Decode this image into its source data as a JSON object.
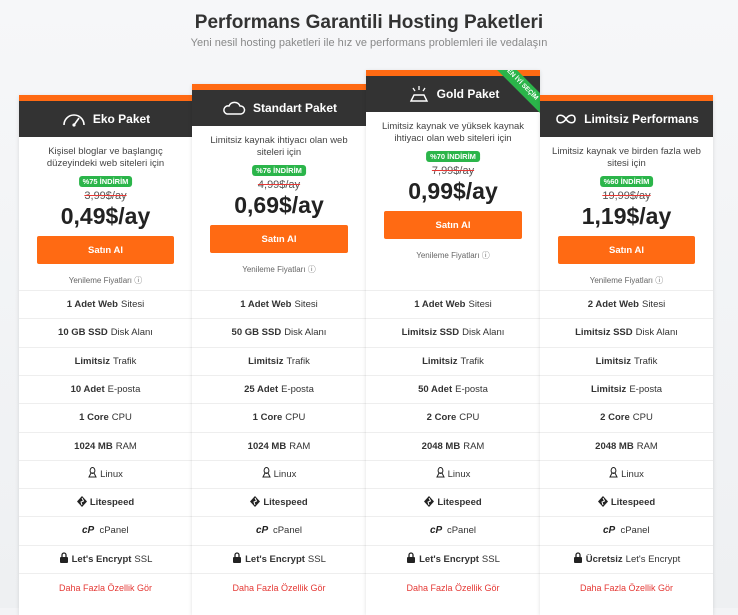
{
  "page": {
    "title": "Performans Garantili Hosting Paketleri",
    "subtitle": "Yeni nesil hosting paketleri ile hız ve performans problemleri ile vedalaşın"
  },
  "plans": [
    {
      "name": "Eko Paket",
      "icon": "speedometer-icon",
      "description": "Kişisel bloglar ve başlangıç düzeyindeki web siteleri için",
      "discount": "%75 İNDİRİM",
      "old_price": "3,99$/ay",
      "price": "0,49$/ay",
      "cta": "Satın Al",
      "renewal": "Yenileme Fiyatları",
      "features": [
        {
          "bold": "1 Adet Web",
          "rest": "Sitesi"
        },
        {
          "bold": "10 GB SSD",
          "rest": "Disk Alanı"
        },
        {
          "bold": "Limitsiz",
          "rest": "Trafik"
        },
        {
          "bold": "10 Adet",
          "rest": "E-posta"
        },
        {
          "bold": "1 Core",
          "rest": "CPU"
        },
        {
          "bold": "1024 MB",
          "rest": "RAM"
        },
        {
          "bold": "",
          "rest": "Linux"
        },
        {
          "bold": "Litespeed",
          "rest": ""
        },
        {
          "bold": "",
          "rest": "cPanel"
        },
        {
          "bold": "Let's Encrypt",
          "rest": "SSL"
        }
      ],
      "more": "Daha Fazla Özellik Gör"
    },
    {
      "name": "Standart Paket",
      "icon": "cloud-icon",
      "description": "Limitsiz kaynak ihtiyacı olan web siteleri için",
      "discount": "%76 İNDİRİM",
      "old_price": "4,99$/ay",
      "price": "0,69$/ay",
      "cta": "Satın Al",
      "renewal": "Yenileme Fiyatları",
      "features": [
        {
          "bold": "1 Adet Web",
          "rest": "Sitesi"
        },
        {
          "bold": "50 GB SSD",
          "rest": "Disk Alanı"
        },
        {
          "bold": "Limitsiz",
          "rest": "Trafik"
        },
        {
          "bold": "25 Adet",
          "rest": "E-posta"
        },
        {
          "bold": "1 Core",
          "rest": "CPU"
        },
        {
          "bold": "1024 MB",
          "rest": "RAM"
        },
        {
          "bold": "",
          "rest": "Linux"
        },
        {
          "bold": "Litespeed",
          "rest": ""
        },
        {
          "bold": "",
          "rest": "cPanel"
        },
        {
          "bold": "Let's Encrypt",
          "rest": "SSL"
        }
      ],
      "more": "Daha Fazla Özellik Gör"
    },
    {
      "name": "Gold Paket",
      "icon": "gold-bar-icon",
      "ribbon": "EN İYİ SEÇİM",
      "description": "Limitsiz kaynak ve yüksek kaynak ihtiyacı olan web siteleri için",
      "discount": "%70 İNDİRİM",
      "old_price": "7,99$/ay",
      "price": "0,99$/ay",
      "cta": "Satın Al",
      "renewal": "Yenileme Fiyatları",
      "features": [
        {
          "bold": "1 Adet Web",
          "rest": "Sitesi"
        },
        {
          "bold": "Limitsiz SSD",
          "rest": "Disk Alanı"
        },
        {
          "bold": "Limitsiz",
          "rest": "Trafik"
        },
        {
          "bold": "50 Adet",
          "rest": "E-posta"
        },
        {
          "bold": "2 Core",
          "rest": "CPU"
        },
        {
          "bold": "2048 MB",
          "rest": "RAM"
        },
        {
          "bold": "",
          "rest": "Linux"
        },
        {
          "bold": "Litespeed",
          "rest": ""
        },
        {
          "bold": "",
          "rest": "cPanel"
        },
        {
          "bold": "Let's Encrypt",
          "rest": "SSL"
        }
      ],
      "more": "Daha Fazla Özellik Gör"
    },
    {
      "name": "Limitsiz Performans",
      "icon": "infinity-icon",
      "description": "Limitsiz kaynak ve birden fazla web sitesi için",
      "discount": "%60 İNDİRİM",
      "old_price": "19,99$/ay",
      "price": "1,19$/ay",
      "cta": "Satın Al",
      "renewal": "Yenileme Fiyatları",
      "features": [
        {
          "bold": "2 Adet Web",
          "rest": "Sitesi"
        },
        {
          "bold": "Limitsiz SSD",
          "rest": "Disk Alanı"
        },
        {
          "bold": "Limitsiz",
          "rest": "Trafik"
        },
        {
          "bold": "Limitsiz",
          "rest": "E-posta"
        },
        {
          "bold": "2 Core",
          "rest": "CPU"
        },
        {
          "bold": "2048 MB",
          "rest": "RAM"
        },
        {
          "bold": "",
          "rest": "Linux"
        },
        {
          "bold": "Litespeed",
          "rest": ""
        },
        {
          "bold": "",
          "rest": "cPanel"
        },
        {
          "bold": "Ücretsiz",
          "rest": "Let's Encrypt"
        }
      ],
      "more": "Daha Fazla Özellik Gör"
    }
  ],
  "colors": {
    "accent": "#ff6a13",
    "header": "#333333",
    "discount": "#2bb54a",
    "link": "#e53935"
  }
}
